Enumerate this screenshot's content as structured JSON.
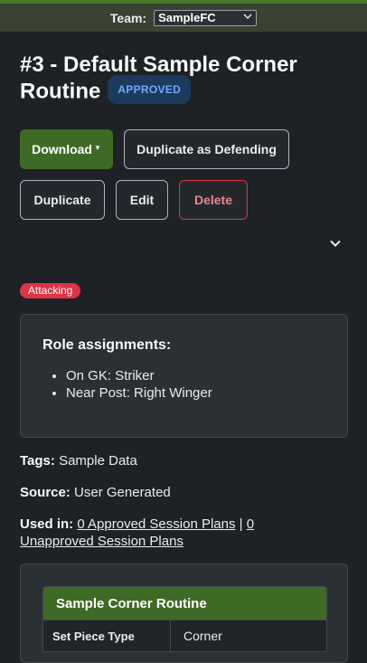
{
  "team_bar": {
    "label": "Team:",
    "selected_team": "SampleFC"
  },
  "header": {
    "title": "#3 - Default Sample Corner Routine",
    "status_badge": "APPROVED"
  },
  "actions": {
    "download": "Download",
    "duplicate_as_defending": "Duplicate as Defending",
    "duplicate": "Duplicate",
    "edit": "Edit",
    "delete": "Delete"
  },
  "type_badge": "Attacking",
  "roles": {
    "heading": "Role assignments:",
    "items": [
      "On GK: Striker",
      "Near Post: Right Winger"
    ]
  },
  "meta": {
    "tags_label": "Tags:",
    "tags_value": "Sample Data",
    "source_label": "Source:",
    "source_value": "User Generated",
    "used_in_label": "Used in:",
    "approved_link": "0 Approved Session Plans",
    "separator": "|",
    "unapproved_link": "0 Unapproved Session Plans"
  },
  "details": {
    "heading": "Sample Corner Routine",
    "rows": [
      {
        "key": "Set Piece Type",
        "value": "Corner"
      }
    ]
  },
  "colors": {
    "accent_green": "#3f6a25",
    "danger": "#dc3545",
    "info": "#6ea8fe"
  }
}
